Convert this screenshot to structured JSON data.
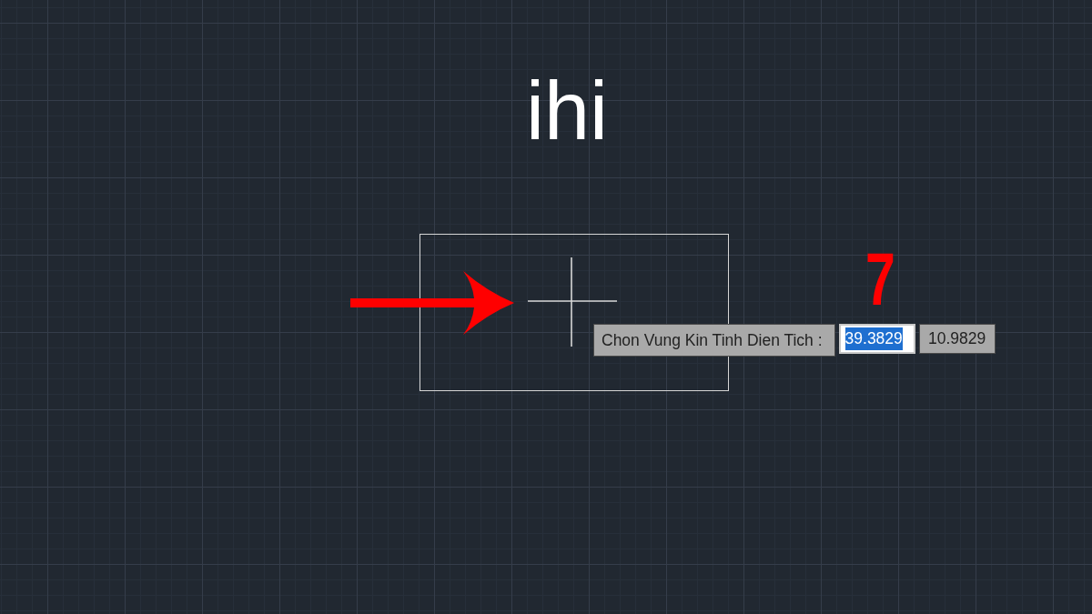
{
  "canvas": {
    "title_text": "ihi",
    "annotation_number": "7",
    "dynamic_input": {
      "prompt": "Chon Vung Kin Tinh Dien Tich :",
      "fields": [
        {
          "value": "39.3829",
          "selected": true
        },
        {
          "value": "10.9829",
          "selected": false
        }
      ]
    }
  }
}
